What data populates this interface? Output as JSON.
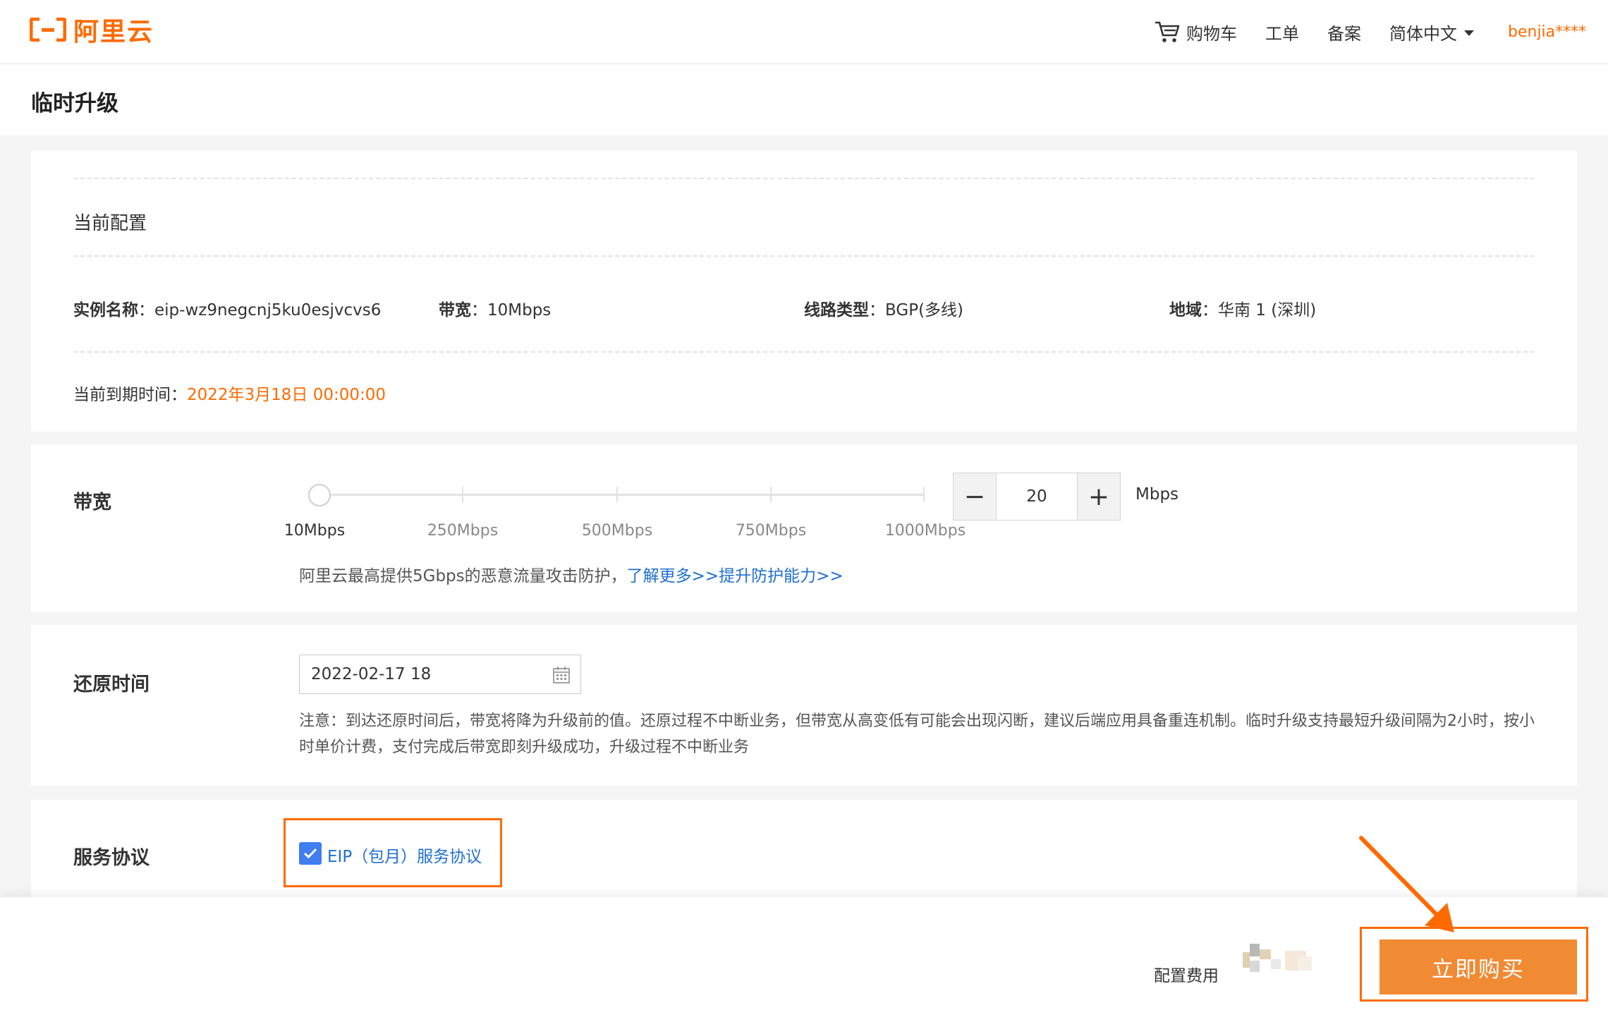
{
  "brand": {
    "name": "阿里云",
    "color": "#ff6a00"
  },
  "nav": {
    "cart": "购物车",
    "ticket": "工单",
    "icp": "备案",
    "language": "简体中文",
    "user": "benjia****"
  },
  "page": {
    "title": "临时升级"
  },
  "config": {
    "title": "当前配置",
    "instance_label": "实例名称",
    "instance_value": "eip-wz9negcnj5ku0esjvcvs6",
    "bandwidth_label": "带宽",
    "bandwidth_value": "10Mbps",
    "line_label": "线路类型",
    "line_value": "BGP(多线)",
    "region_label": "地域",
    "region_value": "华南 1 (深圳)",
    "expire_label": "当前到期时间：",
    "expire_value": "2022年3月18日 00:00:00"
  },
  "bandwidth": {
    "label": "带宽",
    "ticks": [
      "10Mbps",
      "250Mbps",
      "500Mbps",
      "750Mbps",
      "1000Mbps"
    ],
    "value": "20",
    "unit": "Mbps",
    "slider_fraction": 0.01,
    "note": "阿里云最高提供5Gbps的恶意流量攻击防护，",
    "note_link": "了解更多>>提升防护能力>>",
    "minus": "−",
    "plus": "+"
  },
  "restore": {
    "label": "还原时间",
    "date_value": "2022-02-17 18",
    "notice": "注意：到达还原时间后，带宽将降为升级前的值。还原过程不中断业务，但带宽从高变低有可能会出现闪断，建议后端应用具备重连机制。临时升级支持最短升级间隔为2小时，按小时单价计费，支付完成后带宽即刻升级成功，升级过程不中断业务"
  },
  "agreement": {
    "label": "服务协议",
    "link": "EIP（包月）服务协议",
    "checked": true
  },
  "footer": {
    "fee_label": "配置费用",
    "buy_button": "立即购买"
  },
  "colors": {
    "accent": "#ff6a00",
    "link": "#1f6fd1",
    "button": "#f08a33",
    "checkbox": "#3f7df0"
  }
}
